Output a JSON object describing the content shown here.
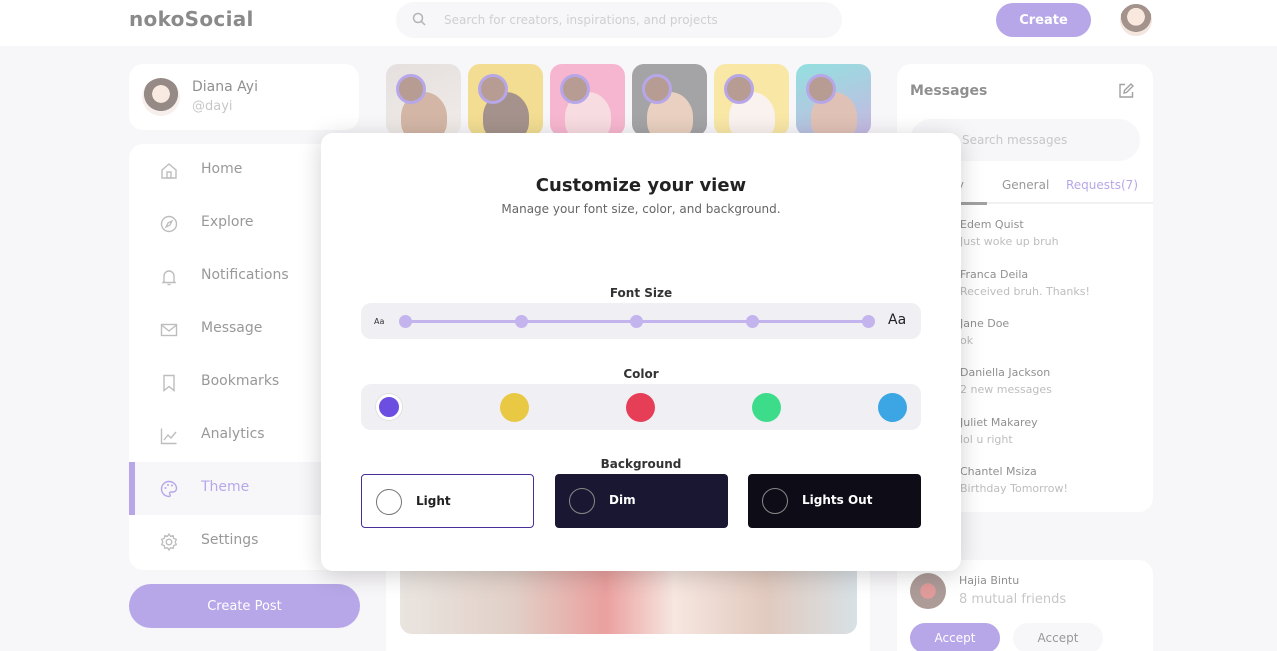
{
  "app": {
    "name": "nokoSocial"
  },
  "search": {
    "placeholder": "Search for creators, inspirations, and projects"
  },
  "header": {
    "create_label": "Create"
  },
  "profile": {
    "name": "Diana Ayi",
    "handle": "@dayi"
  },
  "sidebar": {
    "items": [
      {
        "label": "Home",
        "icon": "home-icon"
      },
      {
        "label": "Explore",
        "icon": "compass-icon"
      },
      {
        "label": "Notifications",
        "icon": "bell-icon"
      },
      {
        "label": "Message",
        "icon": "mail-icon"
      },
      {
        "label": "Bookmarks",
        "icon": "bookmark-icon"
      },
      {
        "label": "Analytics",
        "icon": "analytics-icon"
      },
      {
        "label": "Theme",
        "icon": "palette-icon",
        "active": true
      },
      {
        "label": "Settings",
        "icon": "settings-icon"
      }
    ],
    "create_post_label": "Create Post"
  },
  "messages": {
    "title": "Messages",
    "search_placeholder": "Search messages",
    "tabs": [
      "ry",
      "General",
      "Requests(7)"
    ],
    "items": [
      {
        "name": "Edem Quist",
        "text": "Just woke up bruh"
      },
      {
        "name": "Franca Deila",
        "text": "Received bruh. Thanks!"
      },
      {
        "name": "Jane Doe",
        "text": "ok"
      },
      {
        "name": "Daniella Jackson",
        "text": "2 new messages"
      },
      {
        "name": "Juliet Makarey",
        "text": "lol u right"
      },
      {
        "name": "Chantel Msiza",
        "text": "Birthday Tomorrow!"
      }
    ]
  },
  "request": {
    "name": "Hajia Bintu",
    "mutual": "8 mutual friends",
    "accept_label": "Accept",
    "decline_label": "Accept"
  },
  "modal": {
    "title": "Customize your view",
    "subtitle": "Manage your font size, color, and background.",
    "font_size_label": "Font Size",
    "font_small": "Aa",
    "font_large": "Aa",
    "font_steps": 5,
    "color_label": "Color",
    "colors": [
      "#6c4fe0",
      "#e9c843",
      "#e63e57",
      "#3ddc8a",
      "#3ba6e3"
    ],
    "selected_color": "#6c4fe0",
    "background_label": "Background",
    "backgrounds": [
      {
        "label": "Light",
        "selected": true
      },
      {
        "label": "Dim"
      },
      {
        "label": "Lights Out"
      }
    ]
  },
  "accent": "#7c5fd6"
}
